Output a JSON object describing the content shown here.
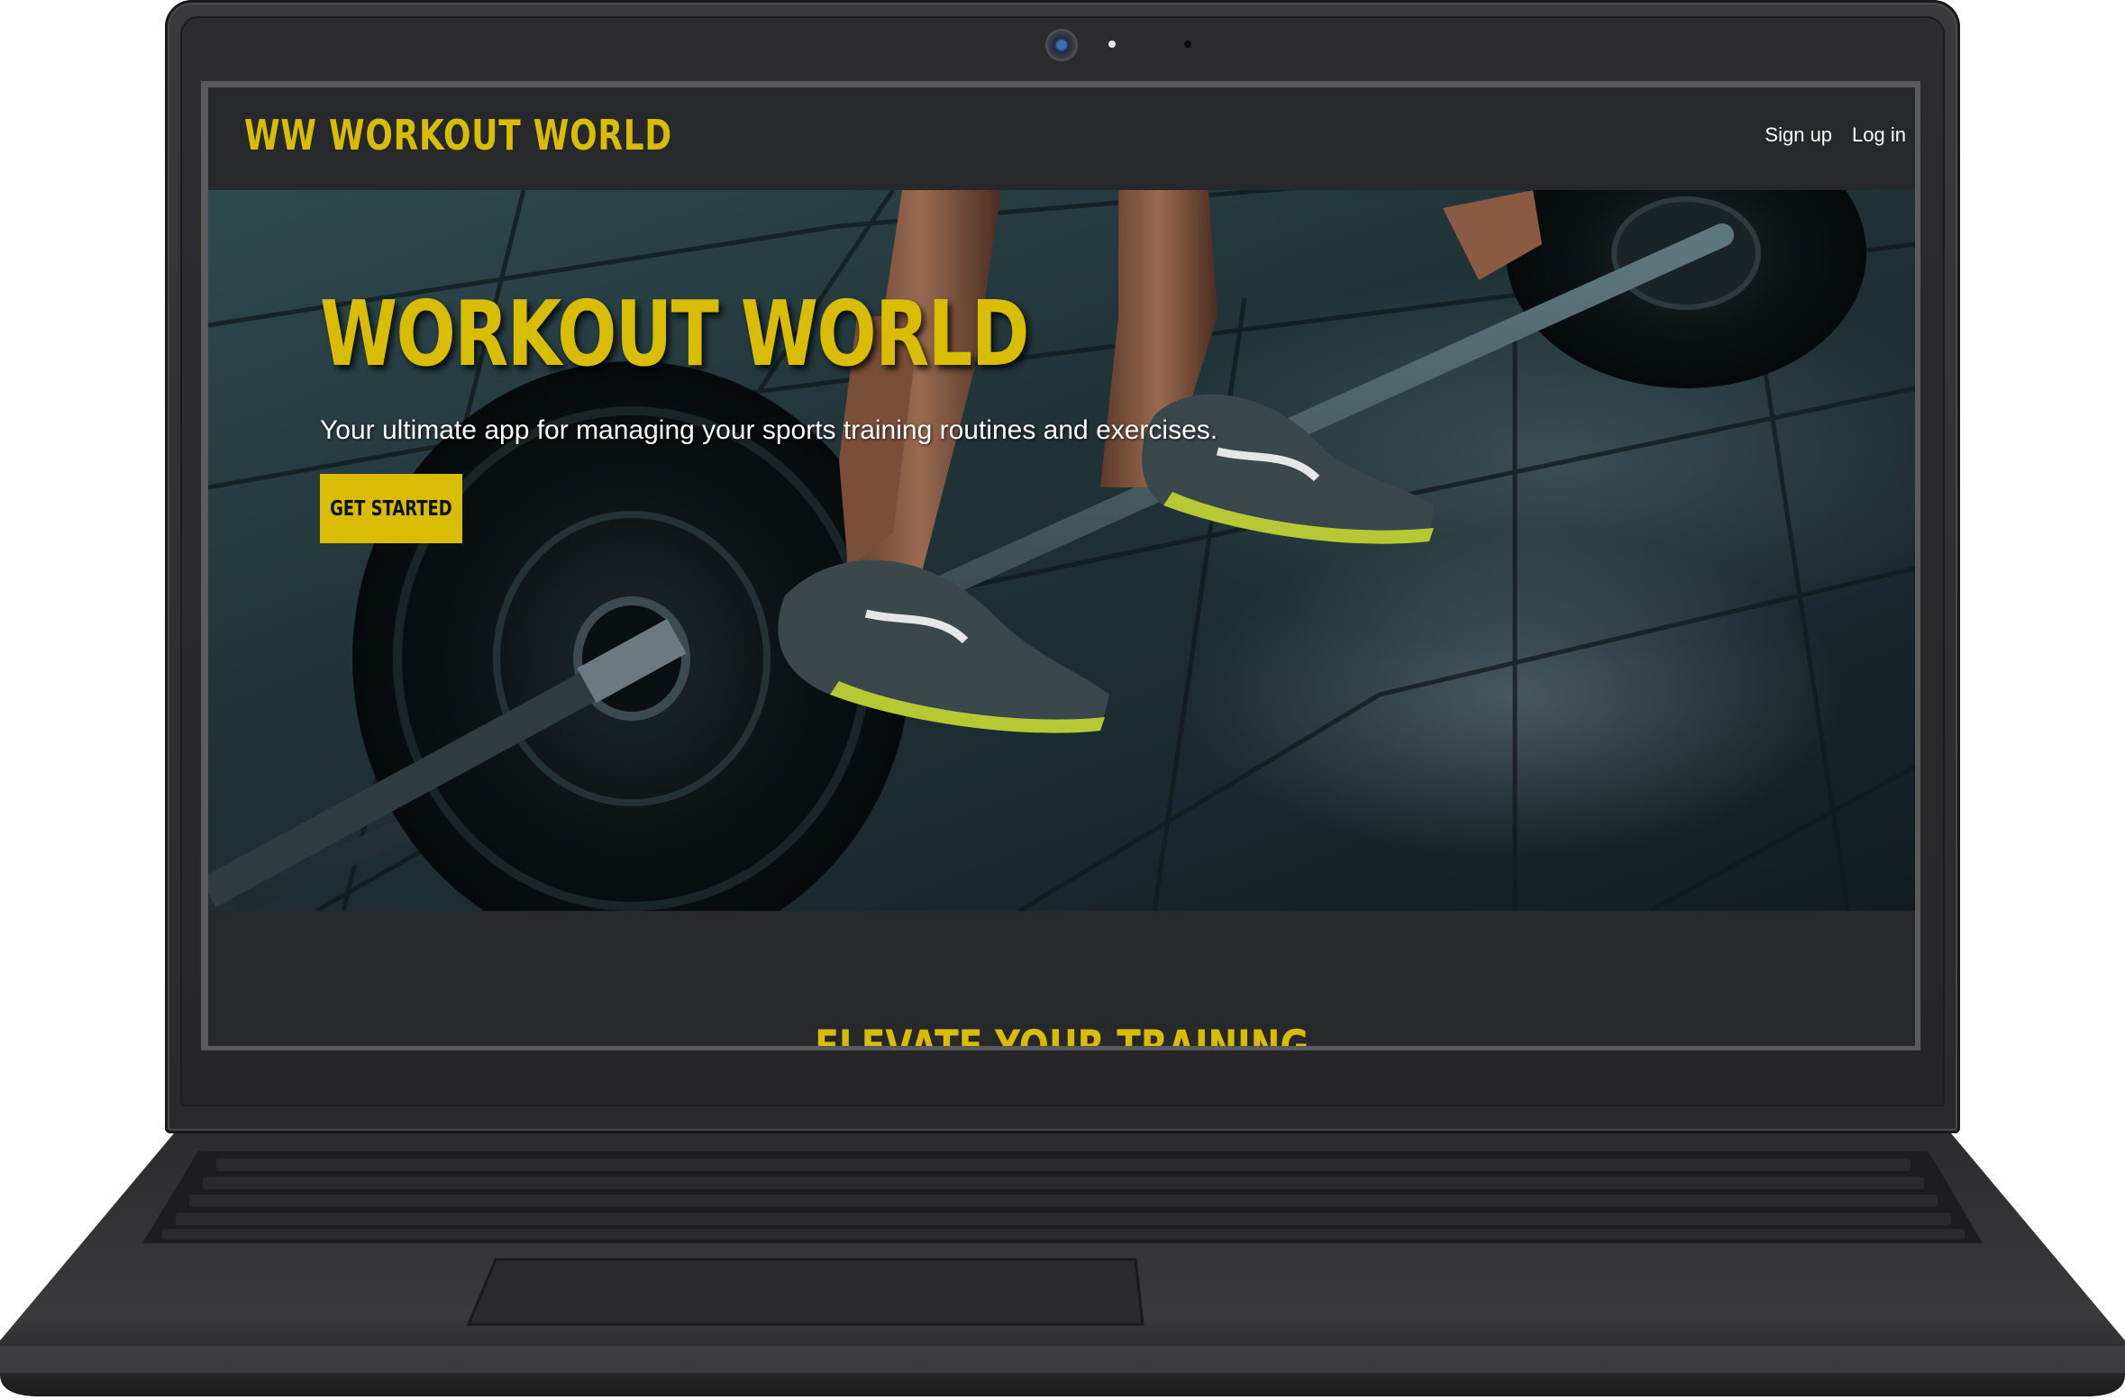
{
  "navbar": {
    "brand": "WW WORKOUT WORLD",
    "links": [
      {
        "label": "Sign up"
      },
      {
        "label": "Log in"
      }
    ]
  },
  "hero": {
    "title": "WORKOUT WORLD",
    "subtitle": "Your ultimate app for managing your sports training routines and exercises.",
    "cta_label": "GET STARTED",
    "image": "barbell-deadlift-photo"
  },
  "section": {
    "heading": "ELEVATE YOUR TRAINING"
  },
  "colors": {
    "accent": "#d9bd05",
    "page_bg": "#27282c",
    "text": "#ffffff",
    "laptop_body": "#2e2e30"
  }
}
